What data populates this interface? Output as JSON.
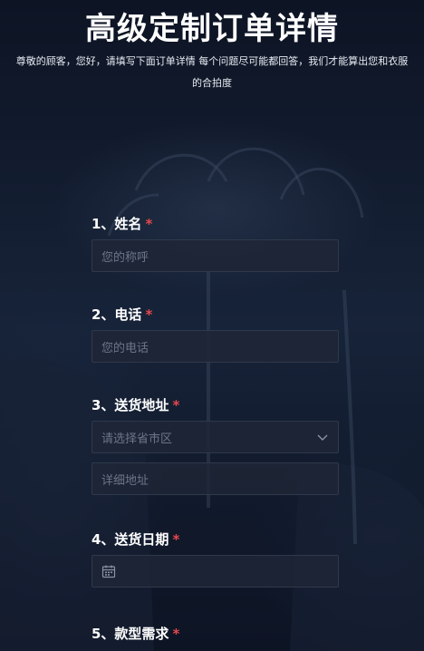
{
  "header": {
    "title": "高级定制订单详情",
    "subtitle": "尊敬的顾客，您好，请填写下面订单详情 每个问题尽可能都回答，我们才能算出您和衣服的合拍度"
  },
  "form": {
    "required_mark": "*",
    "fields": [
      {
        "label": "1、姓名",
        "placeholder": "您的称呼"
      },
      {
        "label": "2、电话",
        "placeholder": "您的电话"
      },
      {
        "label": "3、送货地址",
        "placeholder": "请选择省市区",
        "detail_placeholder": "详细地址",
        "icon": "chevron-down-icon"
      },
      {
        "label": "4、送货日期",
        "placeholder": "",
        "icon": "calendar-icon"
      },
      {
        "label": "5、款型需求"
      }
    ]
  }
}
